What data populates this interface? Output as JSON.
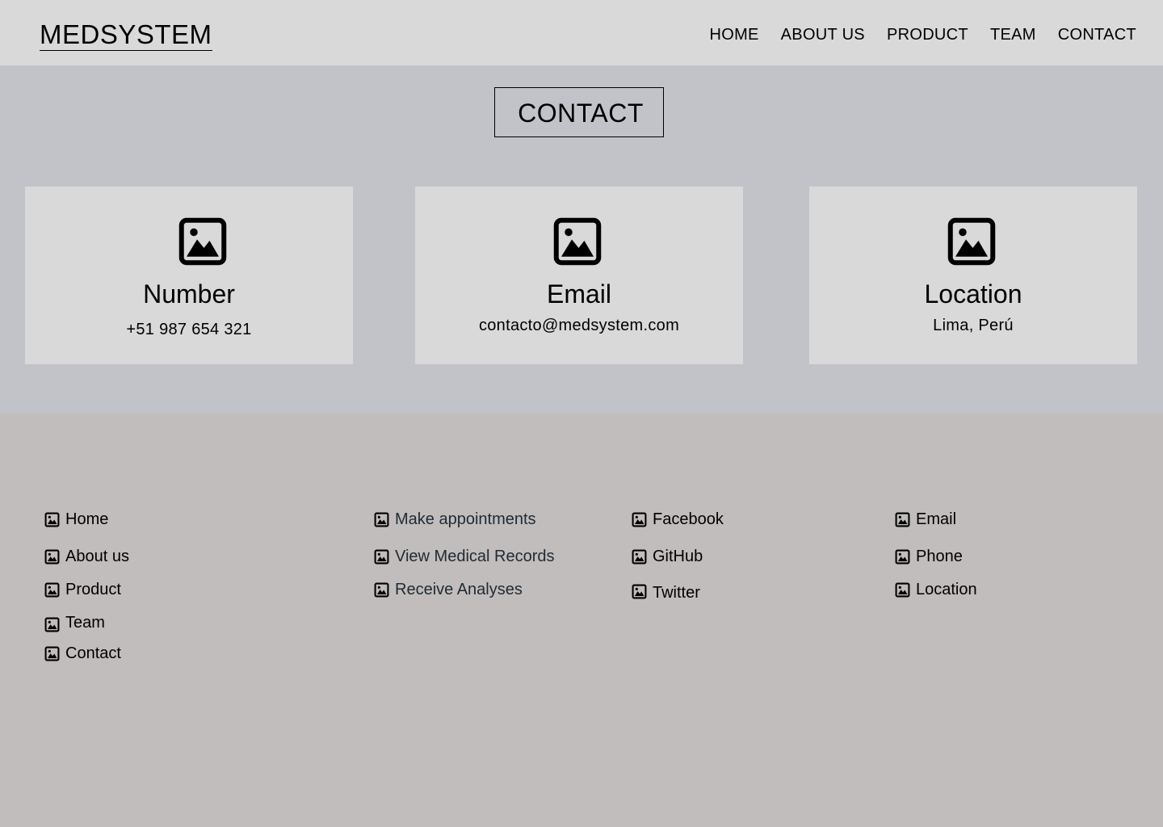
{
  "header": {
    "logo": "MEDSYSTEM",
    "nav": [
      "HOME",
      "ABOUT US",
      "PRODUCT",
      "TEAM",
      "CONTACT"
    ]
  },
  "contact": {
    "title": "CONTACT",
    "cards": [
      {
        "icon": "image-icon",
        "title": "Number",
        "value": "+51 987 654 321"
      },
      {
        "icon": "image-icon",
        "title": "Email",
        "value": "contacto@medsystem.com"
      },
      {
        "icon": "image-icon",
        "title": "Location",
        "value": "Lima, Perú"
      }
    ]
  },
  "footer": {
    "pages": [
      "Home",
      "About us",
      "Product",
      "Team",
      "Contact"
    ],
    "services": [
      "Make appointments",
      "View Medical Records",
      "Receive Analyses"
    ],
    "social": [
      "Facebook",
      "GitHub",
      "Twitter"
    ],
    "contact": [
      "Email",
      "Phone",
      "Location"
    ]
  },
  "colors": {
    "header_bg": "#d9d9d9",
    "contact_bg": "#c2c3c8",
    "card_bg": "#d9d9d9",
    "footer_bg": "#c1bdbc",
    "service_link": "#1f2a33"
  }
}
